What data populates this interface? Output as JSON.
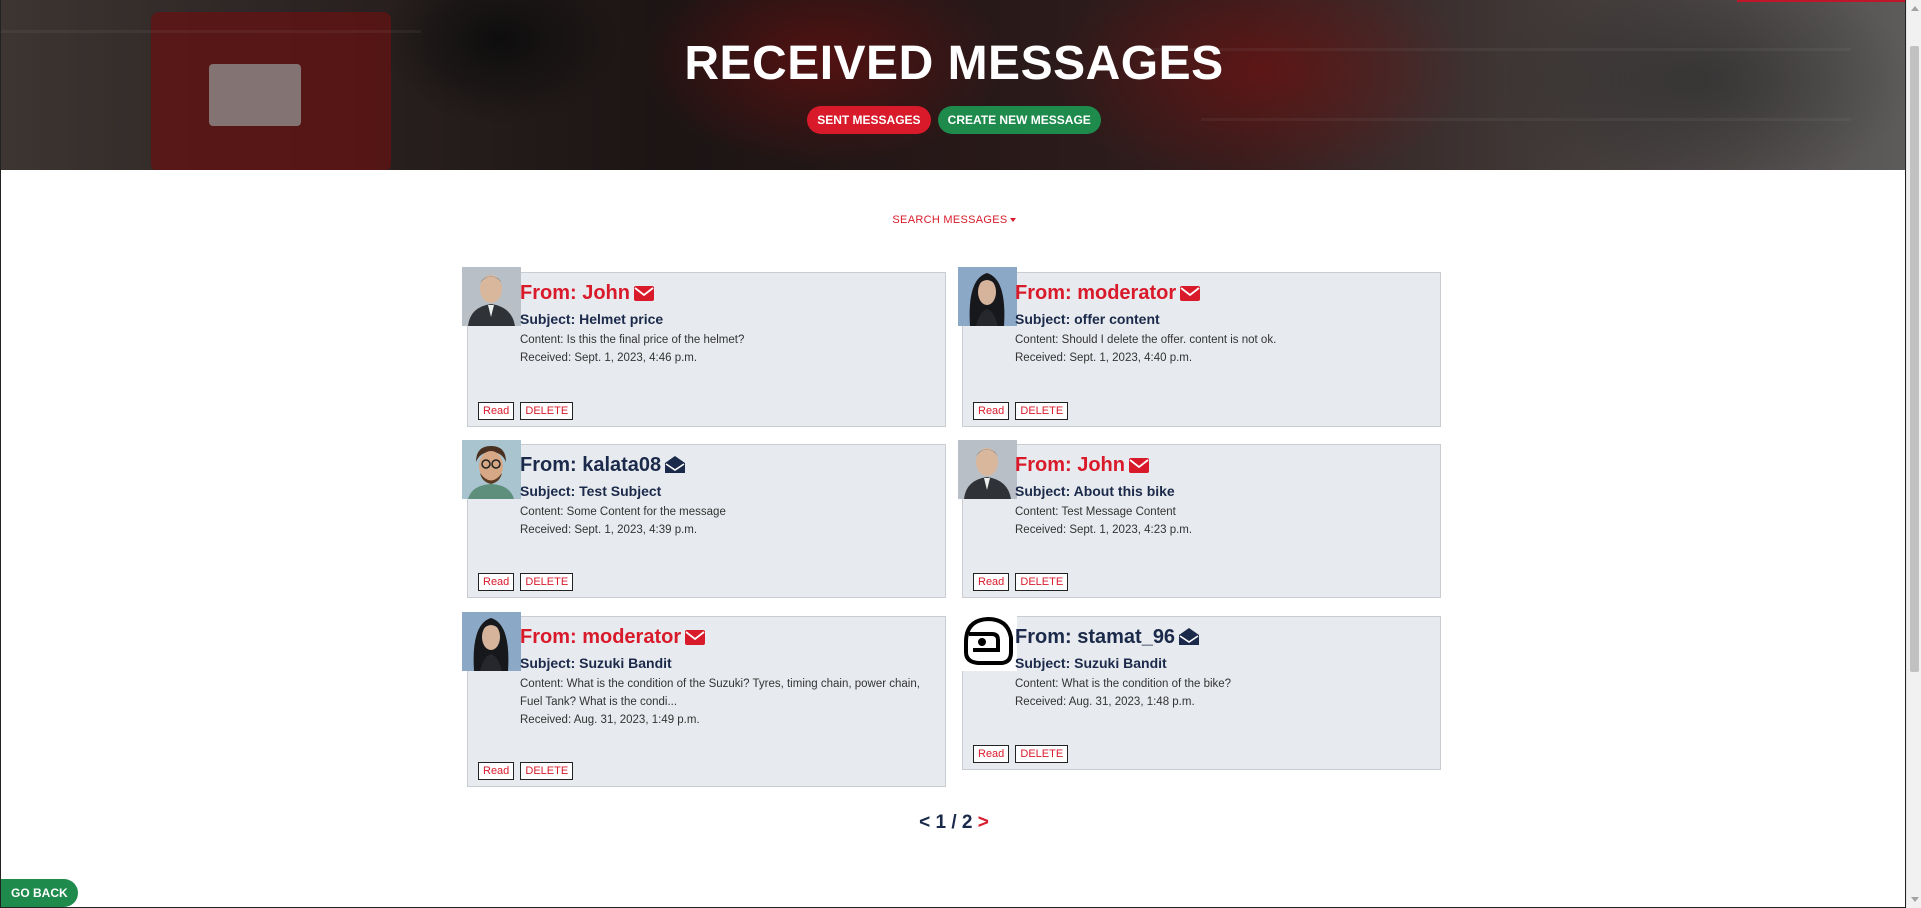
{
  "header": {
    "title": "RECEIVED MESSAGES",
    "sent_messages_label": "SENT MESSAGES",
    "create_message_label": "CREATE NEW MESSAGE"
  },
  "search": {
    "label": "SEARCH MESSAGES"
  },
  "messages": [
    {
      "from": "From: John",
      "subject": "Subject: Helmet price",
      "content": "Content: Is this the final price of the helmet?",
      "received": "Received: Sept. 1, 2023, 4:46 p.m.",
      "status": "unread",
      "avatar": "man-suit"
    },
    {
      "from": "From: moderator",
      "subject": "Subject: offer content",
      "content": "Content: Should I delete the offer. content is not ok.",
      "received": "Received: Sept. 1, 2023, 4:40 p.m.",
      "status": "unread",
      "avatar": "woman-dark-hair"
    },
    {
      "from": "From: kalata08",
      "subject": "Subject: Test Subject",
      "content": "Content: Some Content for the message",
      "received": "Received: Sept. 1, 2023, 4:39 p.m.",
      "status": "read",
      "avatar": "man-glasses"
    },
    {
      "from": "From: John",
      "subject": "Subject: About this bike",
      "content": "Content: Test Message Content",
      "received": "Received: Sept. 1, 2023, 4:23 p.m.",
      "status": "unread",
      "avatar": "man-suit"
    },
    {
      "from": "From: moderator",
      "subject": "Subject: Suzuki Bandit",
      "content": "Content: What is the condition of the Suzuki? Tyres, timing chain, power chain, Fuel Tank? What is the condi...",
      "received": "Received: Aug. 31, 2023, 1:49 p.m.",
      "status": "unread",
      "avatar": "woman-dark-hair"
    },
    {
      "from": "From: stamat_96",
      "subject": "Subject: Suzuki Bandit",
      "content": "Content: What is the condition of the bike?",
      "received": "Received: Aug. 31, 2023, 1:48 p.m.",
      "status": "read",
      "avatar": "helmet-icon"
    }
  ],
  "card_actions": {
    "read_label": "Read",
    "delete_label": "DELETE"
  },
  "pagination": {
    "prev": "<",
    "current": "1",
    "separator": "/",
    "total": "2",
    "next": ">"
  },
  "footer": {
    "go_back_label": "GO BACK"
  },
  "colors": {
    "accent_red": "#d91a2a",
    "accent_green": "#1e8a4c",
    "navy": "#1b2a4a",
    "card_bg": "#e7eaee"
  }
}
